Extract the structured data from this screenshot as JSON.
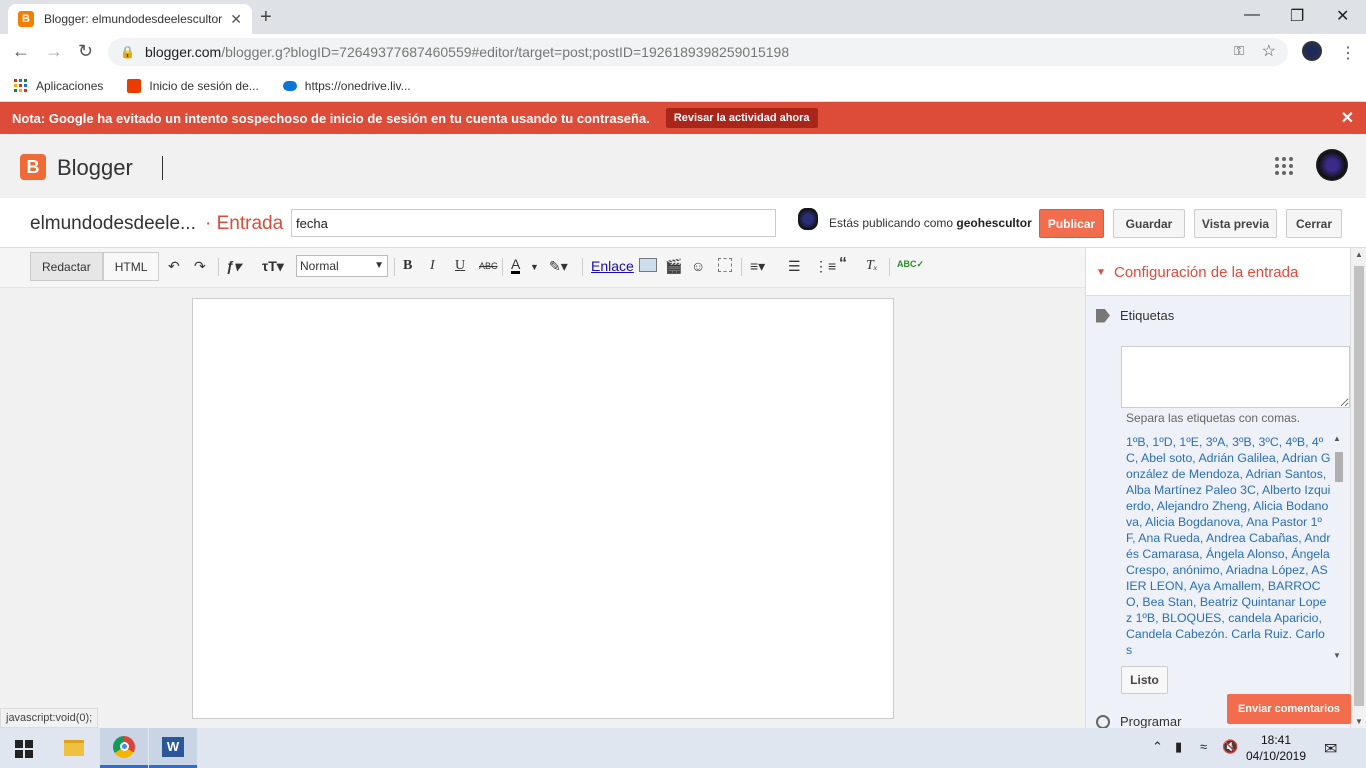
{
  "browser": {
    "tab_title": "Blogger: elmundodesdeelescultor",
    "tab_close": "✕",
    "new_tab": "+",
    "url_host": "blogger.com",
    "url_path": "/blogger.g?blogID=7264937768746055​9#editor/target=post;postID=1926189398259015198",
    "bookmarks": [
      {
        "label": "Aplicaciones"
      },
      {
        "label": "Inicio de sesión de..."
      },
      {
        "label": "https://onedrive.liv..."
      }
    ]
  },
  "banner": {
    "text": "Nota: Google ha evitado un intento sospechoso de inicio de sesión en tu cuenta usando tu contraseña.",
    "button": "Revisar la actividad ahora"
  },
  "header": {
    "logo_letter": "B",
    "brand": "Blogger"
  },
  "postbar": {
    "blog_name": "elmundodesdeele...",
    "entry_label": "· Entrada",
    "title_value": "fecha",
    "publishing_prefix": "Estás publicando como ",
    "publishing_user": "geohescultor",
    "publish": "Publicar",
    "save": "Guardar",
    "preview": "Vista previa",
    "close": "Cerrar"
  },
  "editor": {
    "mode_compose": "Redactar",
    "mode_html": "HTML",
    "format_value": "Normal",
    "link_label": "Enlace"
  },
  "sidebar": {
    "config_title": "Configuración de la entrada",
    "labels_title": "Etiquetas",
    "labels_hint": "Separa las etiquetas con comas.",
    "labels_list": "1ºB, 1ºD, 1ºE, 3ºA, 3ºB, 3ºC, 4ºB, 4ºC, Abel soto, Adrián Galilea, Adrian González de Mendoza, Adrian Santos, Alba Martínez Paleo 3C, Alberto Izquierdo, Alejandro Zheng, Alicia Bodanova, Alicia Bogdanova, Ana Pastor 1ºF, Ana Rueda, Andrea Cabañas, Andrés Camarasa, Ángela Alonso, Ángela Crespo, anónimo, Ariadna López, ASIER LEON, Aya Amallem, BARROCO, Bea Stan, Beatriz Quintanar Lopez 1ºB, BLOQUES, candela Aparicio, Candela Cabezón. Carla Ruiz. Carlos",
    "done": "Listo",
    "schedule": "Programar"
  },
  "feedback": "Enviar comentarios",
  "status_tip": "javascript:void(0);",
  "taskbar": {
    "time": "18:41",
    "date": "04/10/2019"
  },
  "colors": {
    "banner_red": "#dd4b39",
    "blogger_orange": "#f06a35",
    "publish_orange": "#f26d4d",
    "label_link_blue": "#2a6fb5"
  }
}
